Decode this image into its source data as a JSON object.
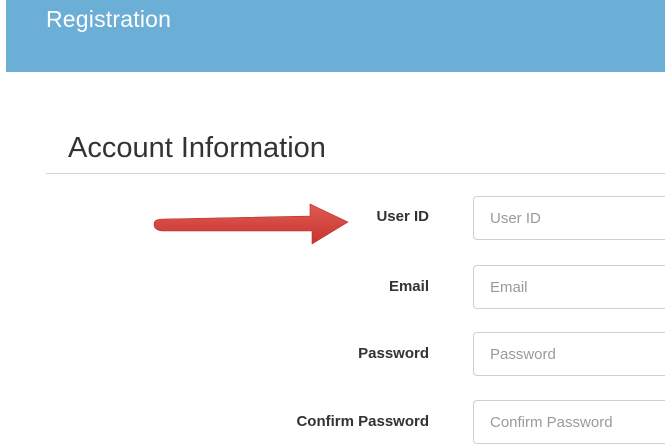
{
  "header": {
    "title": "Registration",
    "background_color": "#6baed6"
  },
  "section": {
    "title": "Account Information"
  },
  "form": {
    "fields": [
      {
        "label": "User ID",
        "placeholder": "User ID",
        "value": ""
      },
      {
        "label": "Email",
        "placeholder": "Email",
        "value": ""
      },
      {
        "label": "Password",
        "placeholder": "Password",
        "value": ""
      },
      {
        "label": "Confirm Password",
        "placeholder": "Confirm Password",
        "value": ""
      }
    ]
  },
  "annotation": {
    "arrow_icon": "arrow-right-icon",
    "arrow_color": "#d9443f"
  }
}
